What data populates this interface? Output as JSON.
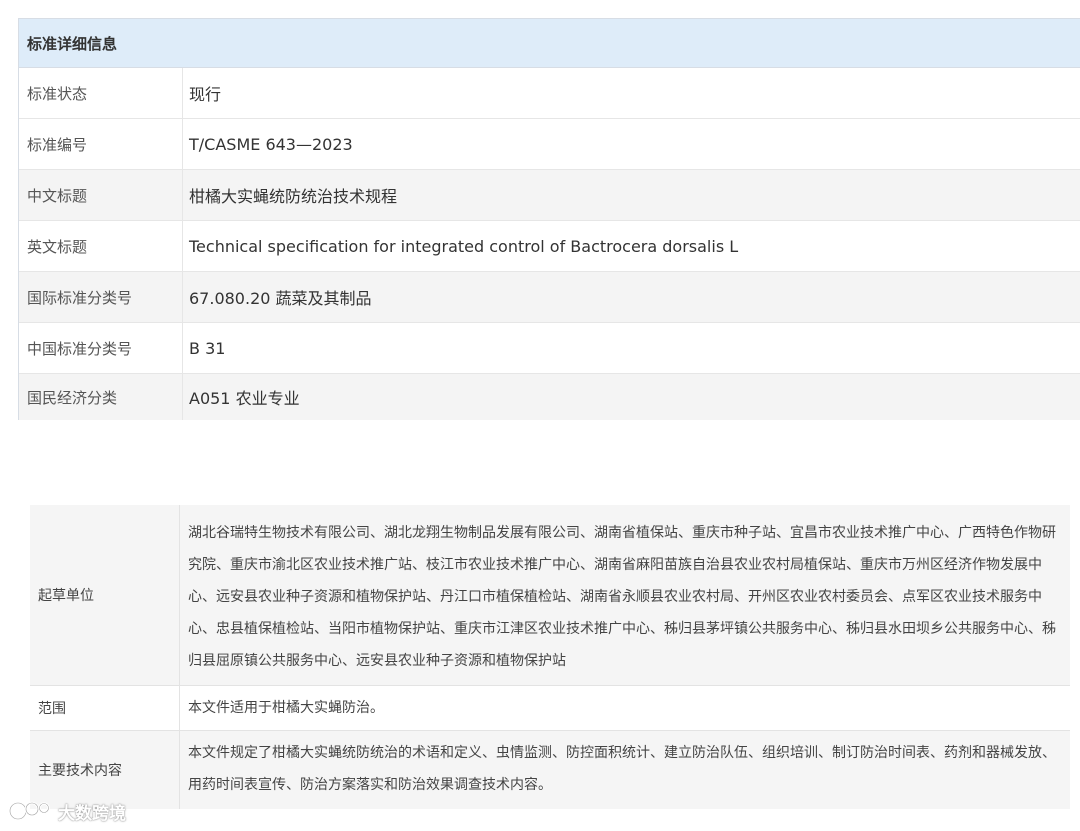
{
  "detail": {
    "header": "标准详细信息",
    "rows": [
      {
        "label": "标准状态",
        "value": "现行"
      },
      {
        "label": "标准编号",
        "value": "T/CASME 643—2023"
      },
      {
        "label": "中文标题",
        "value": "柑橘大实蝇统防统治技术规程"
      },
      {
        "label": "英文标题",
        "value": "Technical specification for integrated control of Bactrocera dorsalis L"
      },
      {
        "label": "国际标准分类号",
        "value": "67.080.20 蔬菜及其制品"
      },
      {
        "label": "中国标准分类号",
        "value": "B 31"
      },
      {
        "label": "国民经济分类",
        "value": "A051 农业专业"
      }
    ]
  },
  "draft": {
    "rows": [
      {
        "label": "起草单位",
        "value": "湖北谷瑞特生物技术有限公司、湖北龙翔生物制品发展有限公司、湖南省植保站、重庆市种子站、宜昌市农业技术推广中心、广西特色作物研究院、重庆市渝北区农业技术推广站、枝江市农业技术推广中心、湖南省麻阳苗族自治县农业农村局植保站、重庆市万州区经济作物发展中心、远安县农业种子资源和植物保护站、丹江口市植保植检站、湖南省永顺县农业农村局、开州区农业农村委员会、点军区农业技术服务中心、忠县植保植检站、当阳市植物保护站、重庆市江津区农业技术推广中心、秭归县茅坪镇公共服务中心、秭归县水田坝乡公共服务中心、秭归县屈原镇公共服务中心、远安县农业种子资源和植物保护站"
      },
      {
        "label": "范围",
        "value": "本文件适用于柑橘大实蝇防治。"
      },
      {
        "label": "主要技术内容",
        "value": "本文件规定了柑橘大实蝇统防统治的术语和定义、虫情监测、防控面积统计、建立防治队伍、组织培训、制订防治时间表、药剂和器械发放、用药时间表宣传、防治方案落实和防治效果调查技术内容。"
      }
    ]
  },
  "watermark": {
    "text": "大数跨境",
    "icon": "brand-logo-icon"
  }
}
